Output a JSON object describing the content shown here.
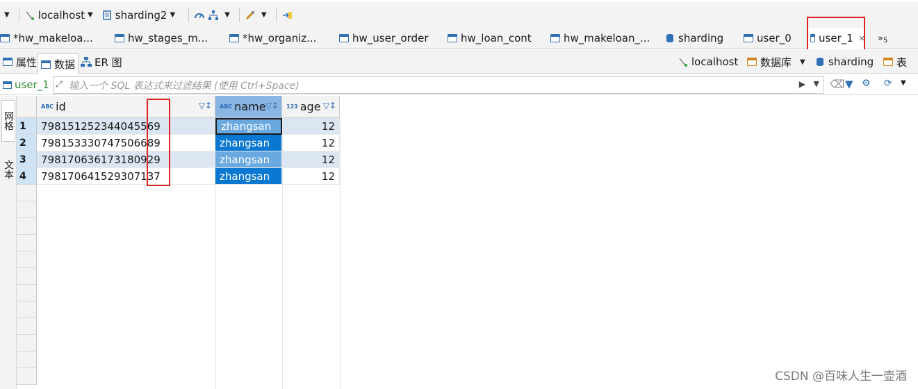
{
  "toolbar": {
    "connection": "localhost",
    "database": "sharding2"
  },
  "editor_tabs": [
    {
      "label": "*hw_makeloa...",
      "icon": "table-icon"
    },
    {
      "label": "hw_stages_m...",
      "icon": "table-icon"
    },
    {
      "label": "*hw_organiz...",
      "icon": "table-icon"
    },
    {
      "label": "hw_user_order",
      "icon": "table-icon"
    },
    {
      "label": "hw_loan_cont",
      "icon": "table-icon"
    },
    {
      "label": "hw_makeloan_...",
      "icon": "table-icon"
    },
    {
      "label": "sharding",
      "icon": "database-icon"
    },
    {
      "label": "user_0",
      "icon": "table-icon"
    },
    {
      "label": "user_1",
      "icon": "table-icon",
      "active": true
    }
  ],
  "more_tabs": "»",
  "more_tabs_count": "5",
  "sub_tabs": {
    "properties": "属性",
    "data": "数据",
    "er": "ER 图"
  },
  "breadcrumb": {
    "host": "localhost",
    "db_type": "数据库",
    "db_name": "sharding",
    "table": "表"
  },
  "filter": {
    "table_name": "user_1",
    "placeholder": "输入一个 SQL 表达式来过滤结果 (使用 Ctrl+Space)"
  },
  "side_tabs": {
    "grid": "网格",
    "text": "文本"
  },
  "table": {
    "columns": [
      {
        "name": "id",
        "type_badge": "ABC"
      },
      {
        "name": "name",
        "type_badge": "ABC"
      },
      {
        "name": "age",
        "type_badge": "123"
      }
    ],
    "rows": [
      {
        "num": "1",
        "id": "798151252344045569",
        "name": "zhangsan",
        "age": "12"
      },
      {
        "num": "2",
        "id": "798153330747506689",
        "name": "zhangsan",
        "age": "12"
      },
      {
        "num": "3",
        "id": "798170636173180929",
        "name": "zhangsan",
        "age": "12"
      },
      {
        "num": "4",
        "id": "798170641529307137",
        "name": "zhangsan",
        "age": "12"
      }
    ]
  },
  "watermark": "CSDN @百味人生一壶酒",
  "colors": {
    "highlight_red": "#e02020",
    "selection_blue": "#0a78d0",
    "header_selected": "#8ab6e4"
  }
}
